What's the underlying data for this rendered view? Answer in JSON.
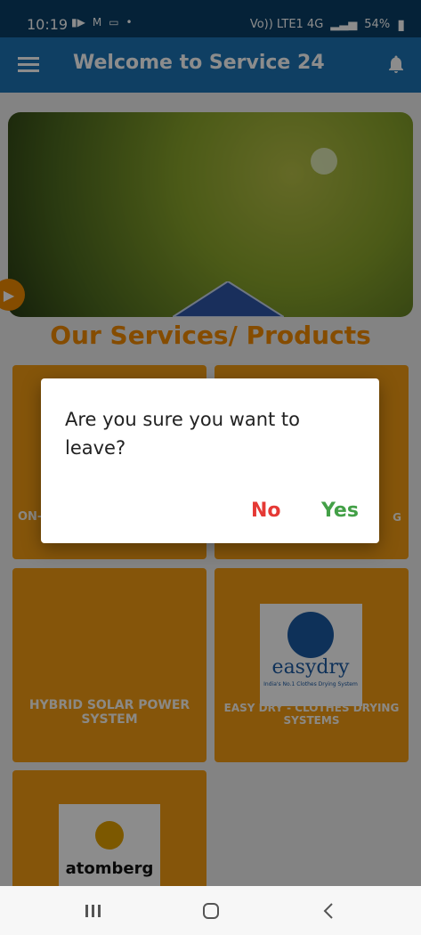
{
  "status_bar": {
    "time": "10:19",
    "signal_text": "Vo)) LTE1 4G",
    "battery": "54%"
  },
  "app_bar": {
    "title": "Welcome to Service 24",
    "menu_icon": "hamburger-menu-icon",
    "bell_icon": "notification-bell-icon"
  },
  "banner": {
    "alt": "solar panels on house held in hand"
  },
  "section": {
    "title": "Our Services/ Products"
  },
  "tiles": [
    {
      "label": "ON-GRID SOLAR POWER SYSTEM",
      "partial": "ON-G"
    },
    {
      "label": "",
      "partial": "G"
    },
    {
      "label": "HYBRID SOLAR POWER SYSTEM"
    },
    {
      "label": "EASY DRY - CLOTHES DRYING SYSTEMS",
      "logo_text": "easydry",
      "logo_sub": "India's No.1 Clothes Drying System"
    },
    {
      "label": "",
      "logo_text": "atomberg"
    }
  ],
  "dialog": {
    "message": "Are you sure you want to leave?",
    "no_label": "No",
    "yes_label": "Yes"
  },
  "nav": {
    "recent_icon": "recent-apps-icon",
    "home_icon": "home-icon",
    "back_icon": "back-icon"
  },
  "colors": {
    "status_bar": "#0a3f66",
    "app_bar": "#1c74b5",
    "tile_orange": "#f39c13",
    "no_red": "#e53935",
    "yes_green": "#43a047"
  }
}
